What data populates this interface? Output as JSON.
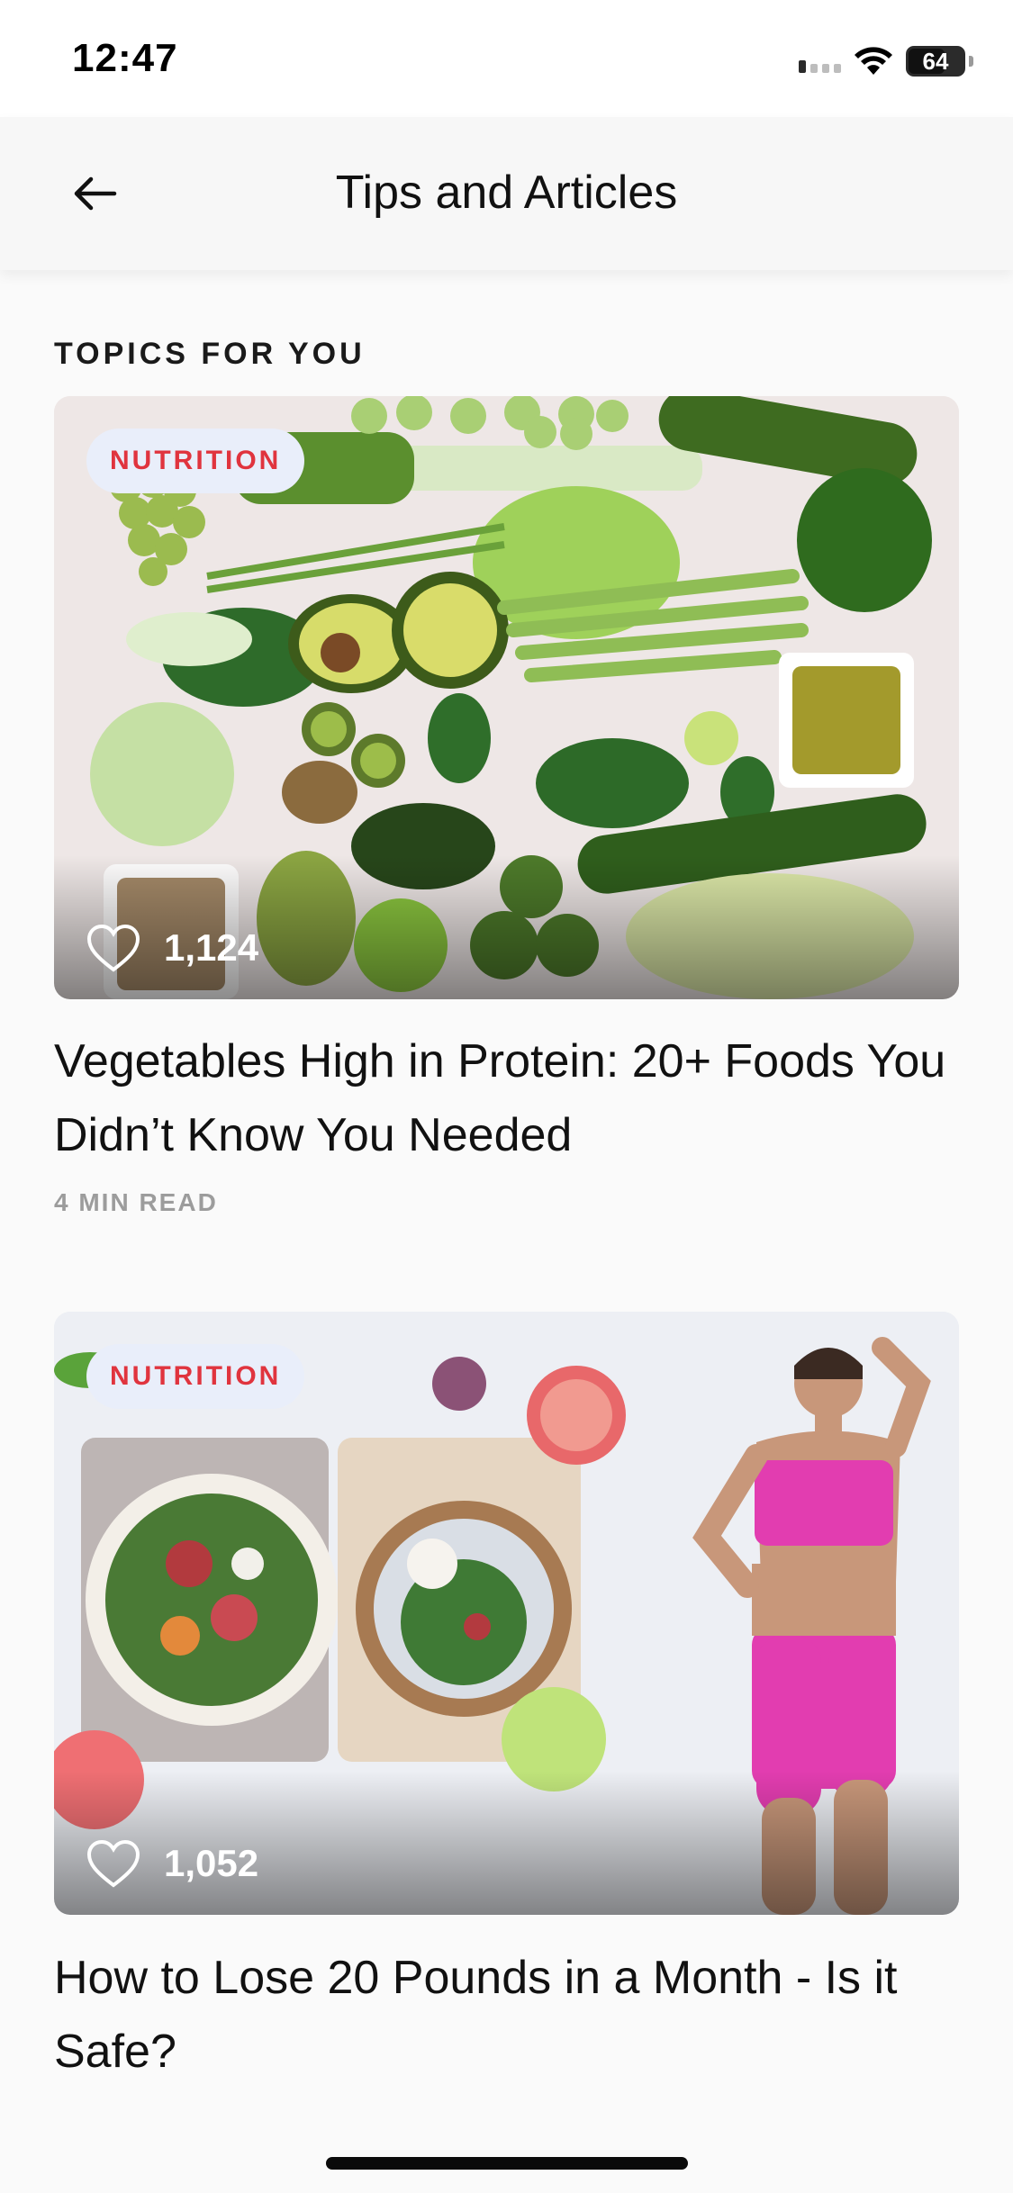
{
  "status_bar": {
    "time": "12:47",
    "battery": "64"
  },
  "header": {
    "title": "Tips and Articles",
    "back_icon": "arrow-left-icon"
  },
  "section": {
    "label": "TOPICS FOR YOU"
  },
  "articles": [
    {
      "tag": "NUTRITION",
      "likes": "1,124",
      "title": "Vegetables High in Protein: 20+ Foods You Didn’t Know You Needed",
      "read_time": "4 MIN READ",
      "image": "green vegetables flat-lay"
    },
    {
      "tag": "NUTRITION",
      "likes": "1,052",
      "title": "How to Lose 20 Pounds in a Month - Is it Safe?",
      "image": "salads and woman in pink activewear"
    }
  ],
  "colors": {
    "tag_text": "#e0343e",
    "tag_bg": "#e9eefa",
    "accent_pink": "#e63fb0"
  }
}
